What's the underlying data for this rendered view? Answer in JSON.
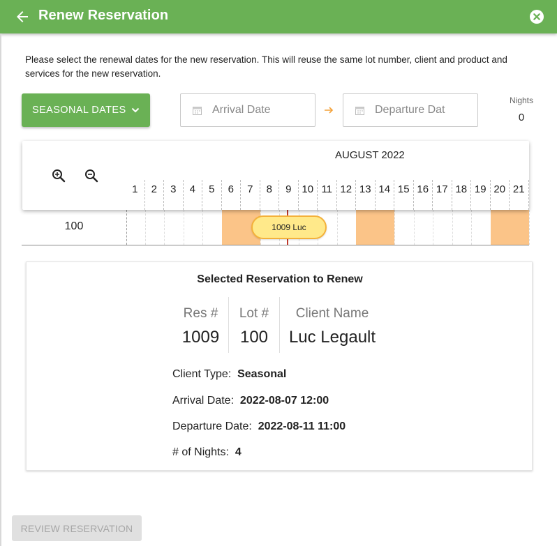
{
  "header": {
    "title": "Renew Reservation",
    "back_icon": "arrow-left-icon",
    "close_icon": "close-circle-icon",
    "color": "#6ab155"
  },
  "intro_text": "Please select the renewal dates for the new reservation. This will reuse the same lot number, client and product and services for the new reservation.",
  "date_controls": {
    "seasonal_button_label": "SEASONAL DATES",
    "arrival_placeholder": "Arrival Date",
    "departure_placeholder": "Departure Dat",
    "nights_label": "Nights",
    "nights_value": "0"
  },
  "timeline": {
    "month_label": "AUGUST 2022",
    "days": [
      "1",
      "2",
      "3",
      "4",
      "5",
      "6",
      "7",
      "8",
      "9",
      "10",
      "11",
      "12",
      "13",
      "14",
      "15",
      "16",
      "17",
      "18",
      "19",
      "20",
      "21"
    ],
    "weekend_days": [
      "6",
      "7",
      "13",
      "14",
      "20",
      "21"
    ],
    "weekend_color": "#fbc488",
    "lot": "100",
    "reservation_label": "1009 Luc"
  },
  "selected": {
    "title": "Selected Reservation to Renew",
    "res_header": "Res #",
    "res_value": "1009",
    "lot_header": "Lot #",
    "lot_value": "100",
    "client_header": "Client Name",
    "client_value": "Luc Legault",
    "client_type_label": "Client Type:",
    "client_type_value": "Seasonal",
    "arrival_label": "Arrival Date:",
    "arrival_value": "2022-08-07 12:00",
    "departure_label": "Departure Date:",
    "departure_value": "2022-08-11 11:00",
    "nights_label": "# of Nights:",
    "nights_value": "4"
  },
  "footer": {
    "review_button": "REVIEW RESERVATION"
  }
}
